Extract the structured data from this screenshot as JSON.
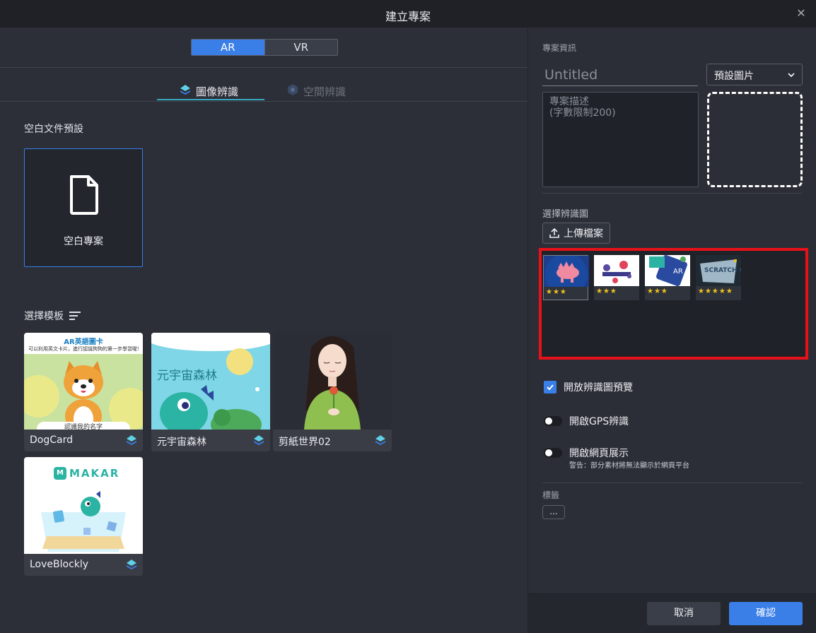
{
  "window": {
    "title": "建立專案",
    "close_icon": "close-icon"
  },
  "mode_toggle": {
    "ar": "AR",
    "vr": "VR",
    "selected": "AR"
  },
  "tabs": [
    {
      "label": "圖像辨識",
      "active": true,
      "icon": "image-recognition-icon"
    },
    {
      "label": "空間辨識",
      "active": false,
      "icon": "spatial-recognition-icon"
    }
  ],
  "blank_section": {
    "label": "空白文件預設",
    "card_label": "空白專案",
    "icon": "document-icon"
  },
  "templates_section": {
    "label": "選擇模板",
    "sort_icon": "sort-icon",
    "items": [
      {
        "name": "DogCard",
        "thumb_title": "AR英語圖卡",
        "thumb_subtitle": "可以利用英文卡片，進行認識狗狗的第一步學習喔！",
        "thumb_footer": "認識我的名字"
      },
      {
        "name": "元宇宙森林",
        "thumb_title": "元宇宙森林"
      },
      {
        "name": "剪紙世界02"
      },
      {
        "name": "LoveBlockly",
        "thumb_title": "MAKAR"
      }
    ]
  },
  "project_info": {
    "label": "專案資訊",
    "title_placeholder": "Untitled",
    "cover_select": "預設圖片",
    "description_placeholder": "專案描述\n(字數限制200)"
  },
  "recognition": {
    "label": "選擇辨識圖",
    "upload_label": "上傳檔案",
    "images": [
      {
        "stars": "★★★",
        "rating": 3
      },
      {
        "stars": "★★★",
        "rating": 3
      },
      {
        "stars": "★★★",
        "rating": 3,
        "badge": "AR"
      },
      {
        "stars": "★★★★★",
        "rating": 5,
        "text": "SCRATCH OFF"
      }
    ]
  },
  "options": {
    "preview_label": "開放辨識圖預覽",
    "preview_checked": true,
    "gps_label": "開啟GPS辨識",
    "gps_on": false,
    "web_label": "開啟網頁展示",
    "web_on": false,
    "web_warning": "警告：部分素材將無法顯示於網頁平台"
  },
  "tags": {
    "label": "標籤",
    "more": "..."
  },
  "footer": {
    "cancel": "取消",
    "confirm": "確認"
  },
  "colors": {
    "accent": "#3a7ee8",
    "highlight": "#e8111a",
    "star": "#f2c21b"
  }
}
